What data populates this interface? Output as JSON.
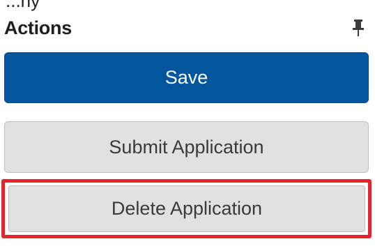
{
  "top_partial_text": "...ny",
  "panel": {
    "title": "Actions",
    "pin_icon": "pin-icon"
  },
  "actions": {
    "save_label": "Save",
    "submit_label": "Submit Application",
    "delete_label": "Delete Application"
  },
  "colors": {
    "primary": "#04569c",
    "secondary_bg": "#e1e1e1",
    "highlight": "#e8232f"
  }
}
